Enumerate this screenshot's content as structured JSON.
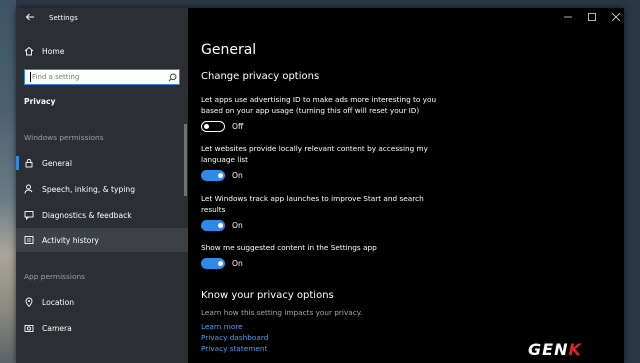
{
  "window": {
    "title": "Settings"
  },
  "sidebar": {
    "home_label": "Home",
    "search_placeholder": "Find a setting",
    "category": "Privacy",
    "windows_permissions_header": "Windows permissions",
    "windows_items": [
      {
        "label": "General",
        "icon": "lock-icon",
        "selected": true
      },
      {
        "label": "Speech, inking, & typing",
        "icon": "person-icon"
      },
      {
        "label": "Diagnostics & feedback",
        "icon": "feedback-icon"
      },
      {
        "label": "Activity history",
        "icon": "activity-icon",
        "hover": true
      }
    ],
    "app_permissions_header": "App permissions",
    "app_items": [
      {
        "label": "Location",
        "icon": "location-icon"
      },
      {
        "label": "Camera",
        "icon": "camera-icon"
      }
    ]
  },
  "main": {
    "title": "General",
    "subtitle": "Change privacy options",
    "options": [
      {
        "text": "Let apps use advertising ID to make ads more interesting to you based on your app usage (turning this off will reset your ID)",
        "state": "Off",
        "on": false
      },
      {
        "text": "Let websites provide locally relevant content by accessing my language list",
        "state": "On",
        "on": true
      },
      {
        "text": "Let Windows track app launches to improve Start and search results",
        "state": "On",
        "on": true
      },
      {
        "text": "Show me suggested content in the Settings app",
        "state": "On",
        "on": true
      }
    ],
    "know": {
      "title": "Know your privacy options",
      "description": "Learn how this setting impacts your privacy.",
      "links": [
        "Learn more",
        "Privacy dashboard",
        "Privacy statement"
      ]
    }
  },
  "watermark": {
    "part1": "GEN",
    "part2": "K"
  },
  "colors": {
    "accent": "#2e8ae6",
    "link": "#4aa3f0",
    "sidebar_bg": "#2b2f33",
    "main_bg": "#000000"
  }
}
